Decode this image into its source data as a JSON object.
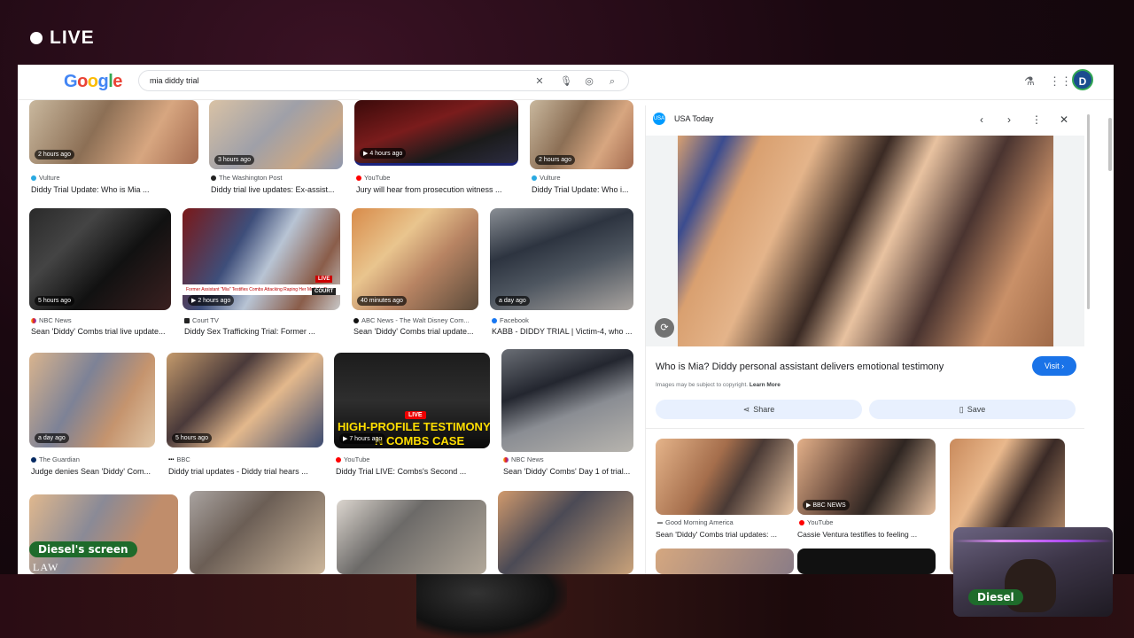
{
  "stream": {
    "live_label": "LIVE",
    "screen_label": "Diesel's screen",
    "cam_label": "Diesel"
  },
  "search": {
    "query": "mia diddy trial",
    "avatar": "D"
  },
  "colors": {
    "accent": "#1a73e8",
    "badge": "#1e6b2b",
    "bg": "#1a0810"
  },
  "results": [
    {
      "badge": "2 hours ago",
      "source": "Vulture",
      "title": "Diddy Trial Update: Who is Mia ...",
      "video": false
    },
    {
      "badge": "3 hours ago",
      "source": "The Washington Post",
      "title": "Diddy trial live updates: Ex-assist...",
      "video": false
    },
    {
      "badge": "4 hours ago",
      "source": "YouTube",
      "title": "Jury will hear from prosecution witness ...",
      "video": true
    },
    {
      "badge": "2 hours ago",
      "source": "Vulture",
      "title": "Diddy Trial Update: Who i...",
      "video": false
    },
    {
      "badge": "5 hours ago",
      "source": "NBC News",
      "title": "Sean 'Diddy' Combs trial live update...",
      "video": false
    },
    {
      "badge": "2 hours ago",
      "source": "Court TV",
      "title": "Diddy Sex Trafficking Trial: Former ...",
      "video": true
    },
    {
      "badge": "40 minutes ago",
      "source": "ABC News - The Walt Disney Com...",
      "title": "Sean 'Diddy' Combs trial update...",
      "video": false
    },
    {
      "badge": "a day ago",
      "source": "Facebook",
      "title": "KABB - DIDDY TRIAL | Victim-4, who ...",
      "video": false
    },
    {
      "badge": "a day ago",
      "source": "The Guardian",
      "title": "Judge denies Sean 'Diddy' Com...",
      "video": false
    },
    {
      "badge": "5 hours ago",
      "source": "BBC",
      "title": "Diddy trial updates - Diddy trial hears ...",
      "video": false
    },
    {
      "badge": "7 hours ago",
      "source": "YouTube",
      "title": "Diddy Trial LIVE: Combs's Second ...",
      "video": true
    },
    {
      "badge": "",
      "source": "NBC News",
      "title": "Sean 'Diddy' Combs' Day 1 of trial...",
      "video": false
    }
  ],
  "thumb_text": {
    "courttv_banner": "Former Assistant \"Mia\" Testifies Combs Attacking Raping Her Multiple Times",
    "courttv_live": "LIVE",
    "courttv_court": "COURT",
    "yt_live": "LIVE",
    "yt_headline1": "HIGH-PROFILE TESTIMONY",
    "yt_headline2": "N COMBS CASE",
    "bbc_overlay": "BBC NEWS",
    "law_watermark": "LAW"
  },
  "side": {
    "source": "USA Today",
    "source_logo": "USA",
    "title": "Who is Mia? Diddy personal assistant delivers emotional testimony",
    "visit": "Visit",
    "copyright": "Images may be subject to copyright.",
    "learn_more": "Learn More",
    "share": "Share",
    "save": "Save",
    "related": [
      {
        "source": "Good Morning America",
        "title": "Sean 'Diddy' Combs trial updates: ..."
      },
      {
        "source": "YouTube",
        "title": "Cassie Ventura testifies to feeling ..."
      }
    ]
  }
}
